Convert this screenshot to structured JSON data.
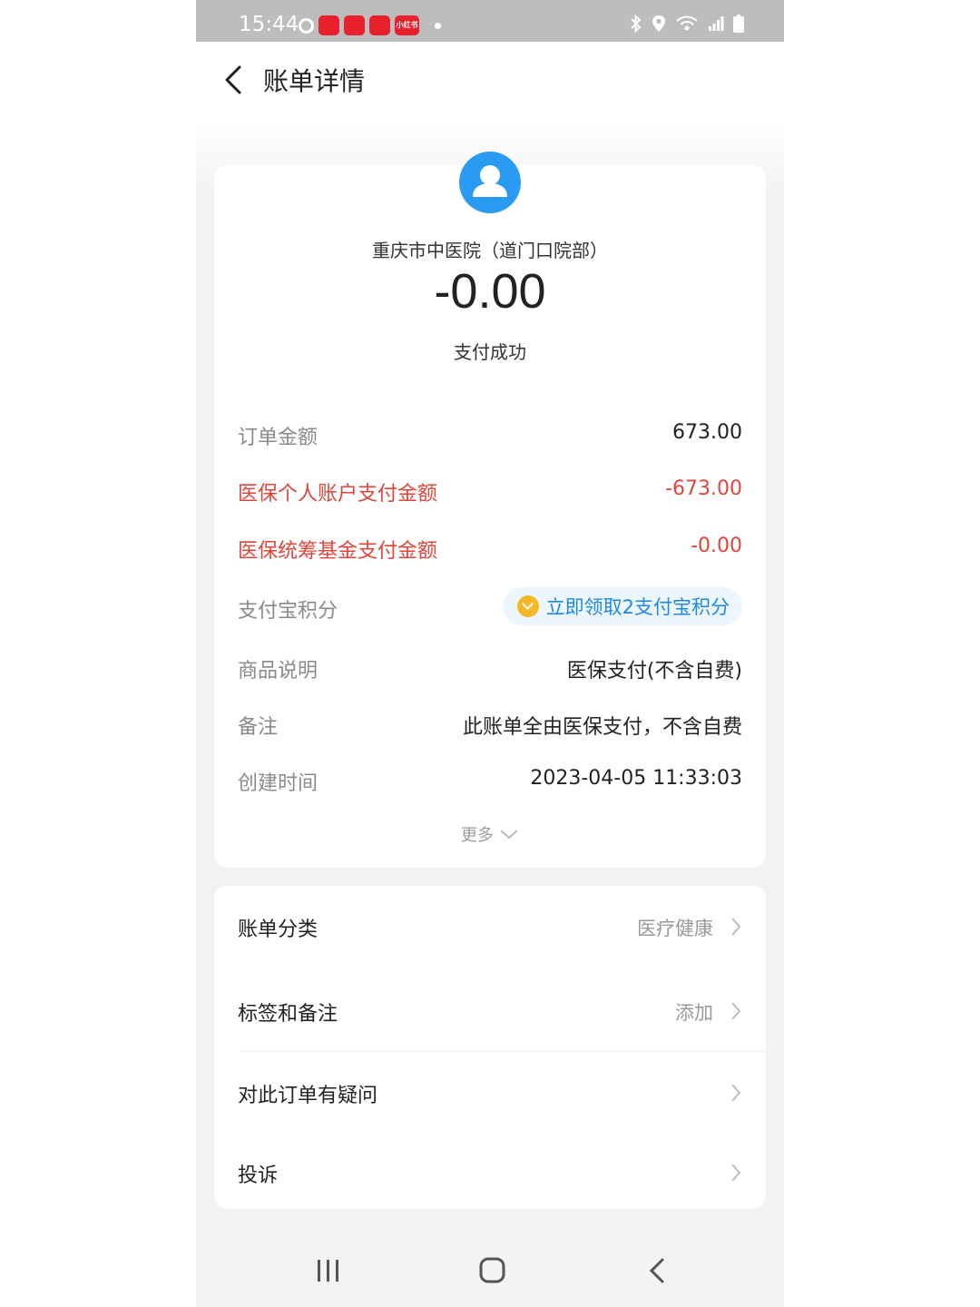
{
  "status_bar": {
    "time": "15:44",
    "notif_icons": [
      "netease-icon",
      "app-icon",
      "app-icon",
      "app-icon",
      "xiaohongshu-icon"
    ],
    "badge_labels": [
      "",
      "",
      "",
      "小红书"
    ],
    "right_icons": [
      "bluetooth-icon",
      "location-icon",
      "wifi-icon",
      "signal-icon",
      "battery-icon"
    ]
  },
  "header": {
    "title": "账单详情",
    "back_icon": "chevron-left-icon"
  },
  "bill": {
    "merchant": "重庆市中医院（道门口院部）",
    "amount": "-0.00",
    "status": "支付成功",
    "avatar_icon": "user-icon",
    "avatar_color": "#2a9bf2"
  },
  "details": {
    "order_amount": {
      "label": "订单金额",
      "value": "673.00"
    },
    "personal_account": {
      "label": "医保个人账户支付金额",
      "value": "-673.00"
    },
    "pooled_fund": {
      "label": "医保统筹基金支付金额",
      "value": "-0.00"
    },
    "points": {
      "label": "支付宝积分",
      "value": "立即领取2支付宝积分"
    },
    "description": {
      "label": "商品说明",
      "value": "医保支付(不含自费)"
    },
    "remark": {
      "label": "备注",
      "value": "此账单全由医保支付，不含自费"
    },
    "created_time": {
      "label": "创建时间",
      "value": "2023-04-05 11:33:03"
    },
    "more": "更多"
  },
  "menu": {
    "category": {
      "label": "账单分类",
      "value": "医疗健康"
    },
    "tags": {
      "label": "标签和备注",
      "value": "添加"
    },
    "question": {
      "label": "对此订单有疑问"
    },
    "complaint": {
      "label": "投诉"
    }
  },
  "colors": {
    "accent_red": "#e0453b",
    "link_blue": "#1e88e5",
    "avatar_blue": "#2a9bf2",
    "points_gold": "#f5b826"
  },
  "nav_bar": [
    "recent-apps-icon",
    "home-icon",
    "back-icon"
  ]
}
